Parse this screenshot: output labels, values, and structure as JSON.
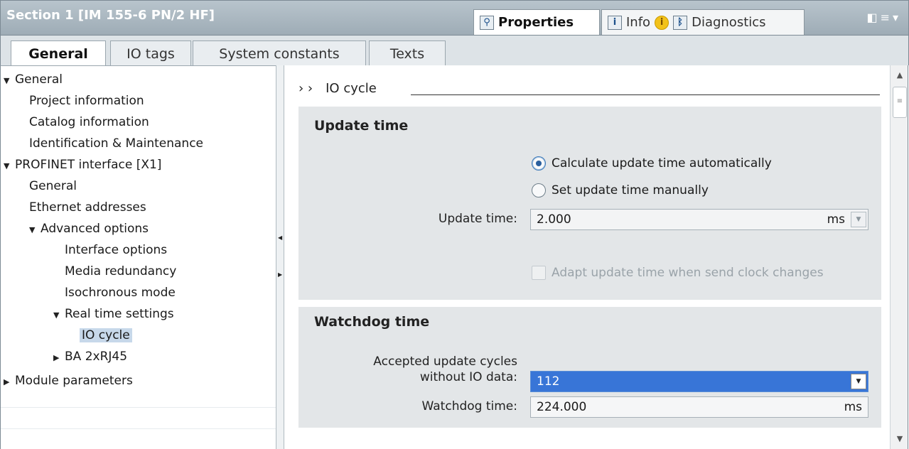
{
  "window": {
    "title": "Section 1 [IM 155-6 PN/2 HF]",
    "tabs": [
      {
        "label": "Properties",
        "icon": "properties-icon"
      },
      {
        "label": "Info",
        "icon": "info-icon"
      },
      {
        "label": "Diagnostics",
        "icon": "diagnostics-icon"
      }
    ]
  },
  "subtabs": [
    "General",
    "IO tags",
    "System constants",
    "Texts"
  ],
  "tree": [
    {
      "label": "General",
      "arrow": "▼"
    },
    {
      "label": "Project information",
      "arrow": ""
    },
    {
      "label": "Catalog information",
      "arrow": ""
    },
    {
      "label": "Identification & Maintenance",
      "arrow": ""
    },
    {
      "label": "PROFINET interface [X1]",
      "arrow": "▼"
    },
    {
      "label": "General",
      "arrow": ""
    },
    {
      "label": "Ethernet addresses",
      "arrow": ""
    },
    {
      "label": "Advanced options",
      "arrow": "▼"
    },
    {
      "label": "Interface options",
      "arrow": ""
    },
    {
      "label": "Media redundancy",
      "arrow": ""
    },
    {
      "label": "Isochronous mode",
      "arrow": ""
    },
    {
      "label": "Real time settings",
      "arrow": "▼"
    },
    {
      "label": "IO cycle",
      "arrow": ""
    },
    {
      "label": "BA 2xRJ45",
      "arrow": "▶"
    },
    {
      "label": "Module parameters",
      "arrow": "▶"
    }
  ],
  "content": {
    "breadcrumb_arrows": "› ›",
    "breadcrumb": "IO cycle",
    "update": {
      "title": "Update time",
      "radio_auto": "Calculate update time automatically",
      "radio_manual": "Set update time manually",
      "field_label": "Update time:",
      "value": "2.000",
      "unit": "ms",
      "checkbox_label": "Adapt update time when send clock changes"
    },
    "watchdog": {
      "title": "Watchdog time",
      "cycles_label_1": "Accepted update cycles",
      "cycles_label_2": "without IO data:",
      "cycles_value": "112",
      "time_label": "Watchdog time:",
      "time_value": "224.000",
      "time_unit": "ms"
    }
  }
}
